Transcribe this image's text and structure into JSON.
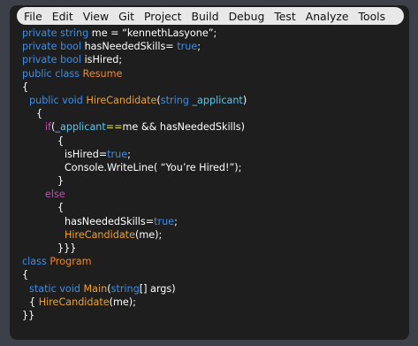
{
  "menubar": {
    "items": [
      "File",
      "Edit",
      "View",
      "Git",
      "Project",
      "Build",
      "Debug",
      "Test",
      "Analyze",
      "Tools"
    ]
  },
  "code": {
    "lines": [
      {
        "indent": 0,
        "tokens": [
          {
            "t": "kw",
            "v": "private string "
          },
          {
            "t": "plain",
            "v": "me = “kennethLasyone”;"
          }
        ]
      },
      {
        "indent": 0,
        "tokens": [
          {
            "t": "kw",
            "v": "private bool "
          },
          {
            "t": "plain",
            "v": "hasNeededSkills= "
          },
          {
            "t": "kw",
            "v": "true"
          },
          {
            "t": "plain",
            "v": ";"
          }
        ]
      },
      {
        "indent": 0,
        "tokens": [
          {
            "t": "kw",
            "v": "private bool "
          },
          {
            "t": "plain",
            "v": "isHired;"
          }
        ]
      },
      {
        "indent": 0,
        "tokens": [
          {
            "t": "kw",
            "v": "public class "
          },
          {
            "t": "type",
            "v": "Resume"
          }
        ]
      },
      {
        "indent": 0,
        "tokens": [
          {
            "t": "plain",
            "v": "{"
          }
        ]
      },
      {
        "indent": 1,
        "tokens": [
          {
            "t": "kw",
            "v": "public void "
          },
          {
            "t": "method",
            "v": "HireCandidate"
          },
          {
            "t": "plain",
            "v": "("
          },
          {
            "t": "kw",
            "v": "string "
          },
          {
            "t": "param",
            "v": "_applicant"
          },
          {
            "t": "plain",
            "v": ")"
          }
        ]
      },
      {
        "indent": 2,
        "tokens": [
          {
            "t": "plain",
            "v": "{"
          }
        ]
      },
      {
        "indent": 3,
        "tokens": [
          {
            "t": "kw2",
            "v": "if"
          },
          {
            "t": "plain",
            "v": "("
          },
          {
            "t": "param",
            "v": "_applicant"
          },
          {
            "t": "op",
            "v": "=="
          },
          {
            "t": "plain",
            "v": "me && hasNeededSkills)"
          }
        ]
      },
      {
        "indent": 4,
        "tokens": [
          {
            "t": "plain",
            "v": "{"
          }
        ]
      },
      {
        "indent": 5,
        "tokens": [
          {
            "t": "plain",
            "v": "isHired="
          },
          {
            "t": "kw",
            "v": "true"
          },
          {
            "t": "plain",
            "v": ";"
          }
        ]
      },
      {
        "indent": 5,
        "tokens": [
          {
            "t": "plain",
            "v": "Console.WriteLine( “You’re Hired!”);"
          }
        ]
      },
      {
        "indent": 4,
        "tokens": [
          {
            "t": "plain",
            "v": "}"
          }
        ]
      },
      {
        "indent": 3,
        "tokens": [
          {
            "t": "kw2",
            "v": "else"
          }
        ]
      },
      {
        "indent": 4,
        "tokens": [
          {
            "t": "plain",
            "v": "{"
          }
        ]
      },
      {
        "indent": 5,
        "tokens": [
          {
            "t": "plain",
            "v": "hasNeededSkills="
          },
          {
            "t": "kw",
            "v": "true"
          },
          {
            "t": "plain",
            "v": ";"
          }
        ]
      },
      {
        "indent": 5,
        "tokens": [
          {
            "t": "method",
            "v": "HireCandidate"
          },
          {
            "t": "plain",
            "v": "(me);"
          }
        ]
      },
      {
        "indent": 4,
        "tokens": [
          {
            "t": "plain",
            "v": "}}}"
          }
        ]
      },
      {
        "indent": 0,
        "tokens": [
          {
            "t": "kw",
            "v": "class "
          },
          {
            "t": "type",
            "v": "Program"
          }
        ]
      },
      {
        "indent": 0,
        "tokens": [
          {
            "t": "plain",
            "v": "{"
          }
        ]
      },
      {
        "indent": 1,
        "tokens": [
          {
            "t": "kw",
            "v": "static void "
          },
          {
            "t": "method",
            "v": "Main"
          },
          {
            "t": "plain",
            "v": "("
          },
          {
            "t": "kw",
            "v": "string"
          },
          {
            "t": "plain",
            "v": "[] args)"
          }
        ]
      },
      {
        "indent": 1,
        "tokens": [
          {
            "t": "plain",
            "v": "{ "
          },
          {
            "t": "method",
            "v": "HireCandidate"
          },
          {
            "t": "plain",
            "v": "(me);"
          }
        ]
      },
      {
        "indent": 0,
        "tokens": [
          {
            "t": "plain",
            "v": "}}"
          }
        ]
      }
    ]
  }
}
